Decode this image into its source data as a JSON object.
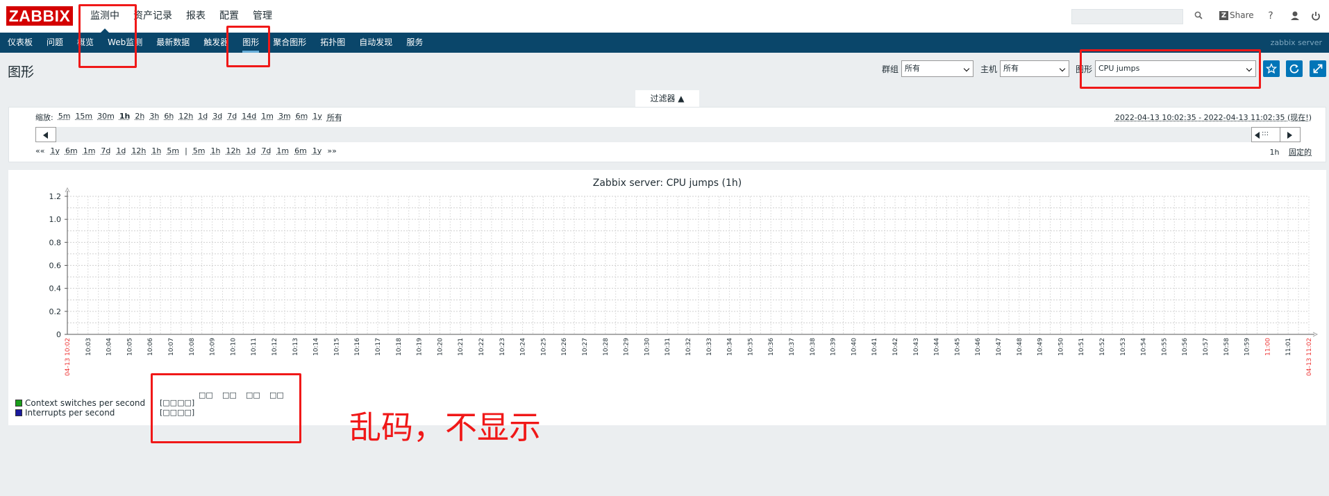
{
  "header": {
    "logo": "ZABBIX",
    "menu": [
      "监测中",
      "资产记录",
      "报表",
      "配置",
      "管理"
    ],
    "search_placeholder": "",
    "share_label": "Share",
    "icons": [
      "search-icon",
      "share-icon",
      "help-icon",
      "user-icon",
      "power-icon"
    ]
  },
  "nav": {
    "items": [
      "仪表板",
      "问题",
      "概览",
      "Web监测",
      "最新数据",
      "触发器",
      "图形",
      "聚合图形",
      "拓扑图",
      "自动发现",
      "服务"
    ],
    "active": "图形",
    "server": "zabbix server"
  },
  "page": {
    "title": "图形",
    "group_label": "群组",
    "group_value": "所有",
    "host_label": "主机",
    "host_value": "所有",
    "graph_label": "图形",
    "graph_value": "CPU jumps",
    "filter_tab": "过滤器 ▲"
  },
  "timeline": {
    "zoom_label": "缩放:",
    "zoom_options": [
      "5m",
      "15m",
      "30m",
      "1h",
      "2h",
      "3h",
      "6h",
      "12h",
      "1d",
      "3d",
      "7d",
      "14d",
      "1m",
      "3m",
      "6m",
      "1y",
      "所有"
    ],
    "zoom_selected": "1h",
    "range": "2022-04-13 10:02:35 - 2022-04-13 11:02:35 (现在!)",
    "shift_back": [
      "««",
      "1y",
      "6m",
      "1m",
      "7d",
      "1d",
      "12h",
      "1h",
      "5m",
      "|",
      "5m",
      "1h",
      "12h",
      "1d",
      "7d",
      "1m",
      "6m",
      "1y",
      "»»"
    ],
    "period": "1h",
    "fixed": "固定的",
    "handle": ":::"
  },
  "graph": {
    "title": "Zabbix server: CPU jumps (1h)",
    "legend": [
      {
        "name": "Context switches per second",
        "color": "#1a9e1a",
        "vals": "[□□□□]"
      },
      {
        "name": "Interrupts per second",
        "color": "#1a1a9e",
        "vals": "[□□□□]"
      }
    ],
    "legend_headers": [
      "□□",
      "□□",
      "□□",
      "□□"
    ]
  },
  "chart_data": {
    "type": "line",
    "title": "Zabbix server: CPU jumps (1h)",
    "ylim": [
      0,
      1.2
    ],
    "yticks": [
      "0",
      "0.2",
      "0.4",
      "0.6",
      "0.8",
      "1.0",
      "1.2"
    ],
    "x_start_label": "04-13 10:02",
    "x_end_label": "04-13 11:02",
    "xticks": [
      "10:03",
      "10:04",
      "10:05",
      "10:06",
      "10:07",
      "10:08",
      "10:09",
      "10:10",
      "10:11",
      "10:12",
      "10:13",
      "10:14",
      "10:15",
      "10:16",
      "10:17",
      "10:18",
      "10:19",
      "10:20",
      "10:21",
      "10:22",
      "10:23",
      "10:24",
      "10:25",
      "10:26",
      "10:27",
      "10:28",
      "10:29",
      "10:30",
      "10:31",
      "10:32",
      "10:33",
      "10:34",
      "10:35",
      "10:36",
      "10:37",
      "10:38",
      "10:39",
      "10:40",
      "10:41",
      "10:42",
      "10:43",
      "10:44",
      "10:45",
      "10:46",
      "10:47",
      "10:48",
      "10:49",
      "10:50",
      "10:51",
      "10:52",
      "10:53",
      "10:54",
      "10:55",
      "10:56",
      "10:57",
      "10:58",
      "10:59",
      "11:00",
      "11:01",
      "11:02"
    ],
    "highlight_ticks": [
      "11:00"
    ],
    "series": [
      {
        "name": "Context switches per second",
        "values": []
      },
      {
        "name": "Interrupts per second",
        "values": []
      }
    ]
  },
  "annotation": {
    "text": "乱码，不显示",
    "color": "#f01818"
  }
}
